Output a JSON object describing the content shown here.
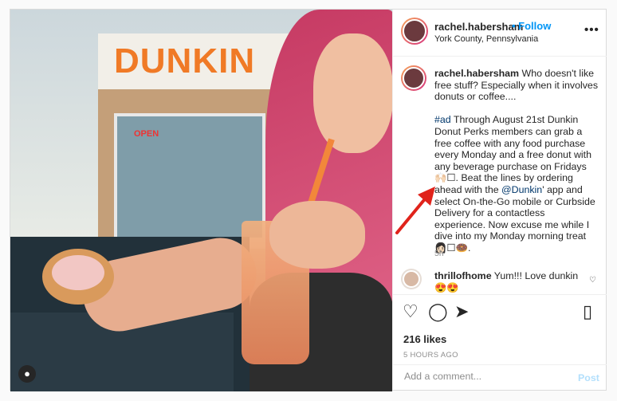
{
  "header": {
    "username": "rachel.habersham",
    "follow_label": "• Follow",
    "location": "York County, Pennsylvania",
    "more_label": "•••"
  },
  "photo": {
    "store_sign": "DUNKIN",
    "open_sign": "OPEN"
  },
  "caption": {
    "username": "rachel.habersham",
    "text1": " Who doesn't like free stuff? Especially when it involves donuts or coffee....",
    "hashtag": "#ad",
    "text2": " Through August 21st Dunkin Donut Perks members can grab a free coffee with any food purchase every Monday and a free donut with any beverage purchase on Fridays 🙌🏻☐. Beat the lines by ordering ahead with the ",
    "mention": "@Dunkin",
    "text3": "' app and select On-the-Go mobile or Curbside Delivery for a contactless experience. Now excuse me while I dive into my Monday morning treat 👩🏻☐🍩.",
    "time": "5h"
  },
  "comments": [
    {
      "username": "thrillofhome",
      "text": " Yum!!! Love dunkin 😍😍"
    }
  ],
  "actions": {
    "likes": "216 likes",
    "time_ago": "5 HOURS AGO"
  },
  "add_comment": {
    "placeholder": "Add a comment...",
    "post_label": "Post"
  },
  "colors": {
    "accent": "#0095f6",
    "arrow": "#e0231b"
  }
}
